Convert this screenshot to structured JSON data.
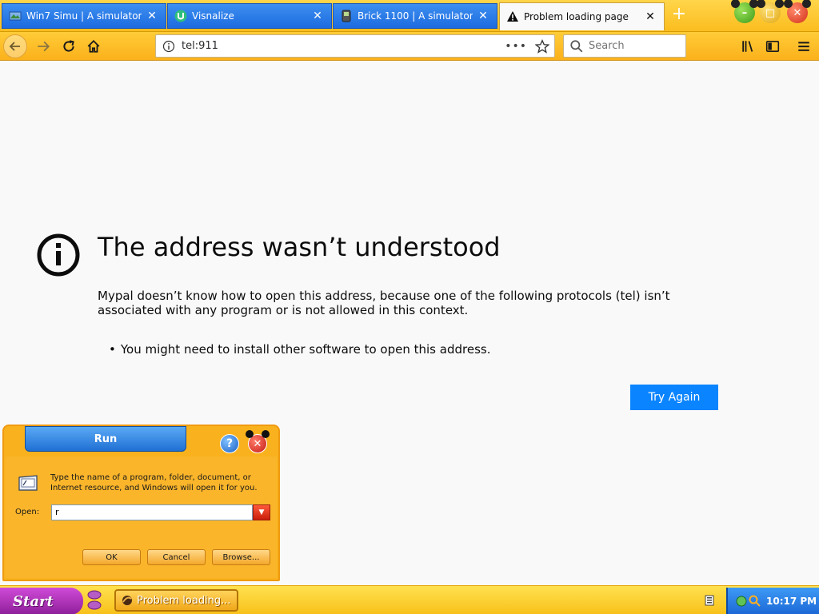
{
  "browser": {
    "tabs": [
      {
        "label": "Win7 Simu | A simulator ...",
        "icon": "globe-icon"
      },
      {
        "label": "Visnalize",
        "icon": "visnalize-logo-icon"
      },
      {
        "label": "Brick 1100 | A simulator ...",
        "icon": "phone-icon"
      },
      {
        "label": "Problem loading page",
        "icon": "warning-icon",
        "active": true
      }
    ],
    "url": "tel:911",
    "search_placeholder": "Search"
  },
  "error_page": {
    "title": "The address wasn’t understood",
    "description": "Mypal doesn’t know how to open this address, because one of the following protocols (tel) isn’t associated with any program or is not allowed in this context.",
    "bullets": [
      "You might need to install other software to open this address."
    ],
    "button_label": "Try Again"
  },
  "run_dialog": {
    "title": "Run",
    "description": "Type the name of a program, folder, document, or Internet resource, and Windows will open it for you.",
    "open_label": "Open:",
    "open_value": "r",
    "ok_label": "OK",
    "cancel_label": "Cancel",
    "browse_label": "Browse...",
    "help_label": "?",
    "close_label": "✕"
  },
  "taskbar": {
    "start_label": "Start",
    "task_label": "Problem loading...",
    "clock": "10:17 PM"
  },
  "colors": {
    "accent_blue": "#0a84ff",
    "theme_orange": "#fbb11b",
    "tab_blue": "#1d6be0",
    "start_purple": "#8d1f99"
  }
}
